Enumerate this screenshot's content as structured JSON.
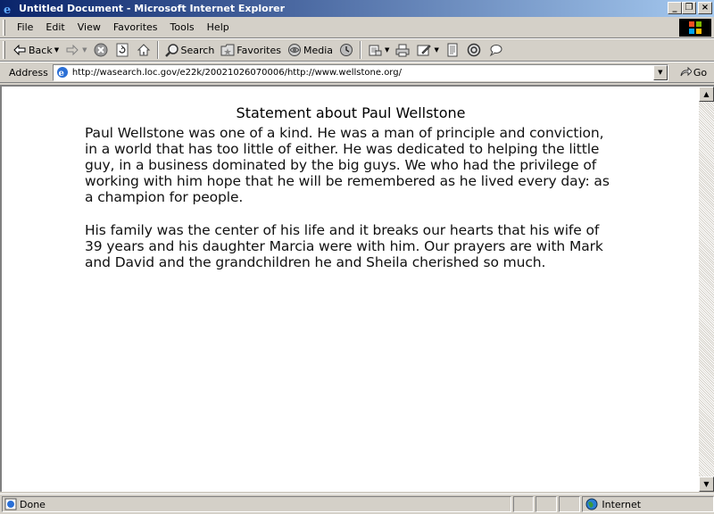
{
  "window": {
    "title": "Untitled Document - Microsoft Internet Explorer",
    "controls": {
      "minimize": "_",
      "maximize": "❐",
      "close": "×"
    }
  },
  "menu": {
    "items": [
      "File",
      "Edit",
      "View",
      "Favorites",
      "Tools",
      "Help"
    ]
  },
  "toolbar": {
    "back_label": "Back",
    "search_label": "Search",
    "favorites_label": "Favorites",
    "media_label": "Media"
  },
  "address": {
    "label": "Address",
    "url": "http://wasearch.loc.gov/e22k/20021026070006/http://www.wellstone.org/",
    "go_label": "Go"
  },
  "document": {
    "title": "Statement about Paul Wellstone",
    "paragraphs": [
      "Paul Wellstone was one of a kind. He was a man of principle and conviction, in a world that has too little of either. He was dedicated to helping the little guy, in a business dominated by the big guys. We who had the privilege of working with him hope that he will be remembered as he lived every day: as a champion for people.",
      "His family was the center of his life and it breaks our hearts that his wife of 39 years and his daughter Marcia were with him. Our prayers are with Mark and David and the grandchildren he and Sheila cherished so much."
    ]
  },
  "status": {
    "text": "Done",
    "zone": "Internet"
  },
  "colors": {
    "titlebar_start": "#0a246a",
    "titlebar_end": "#a6caf0",
    "chrome": "#d4d0c8"
  }
}
